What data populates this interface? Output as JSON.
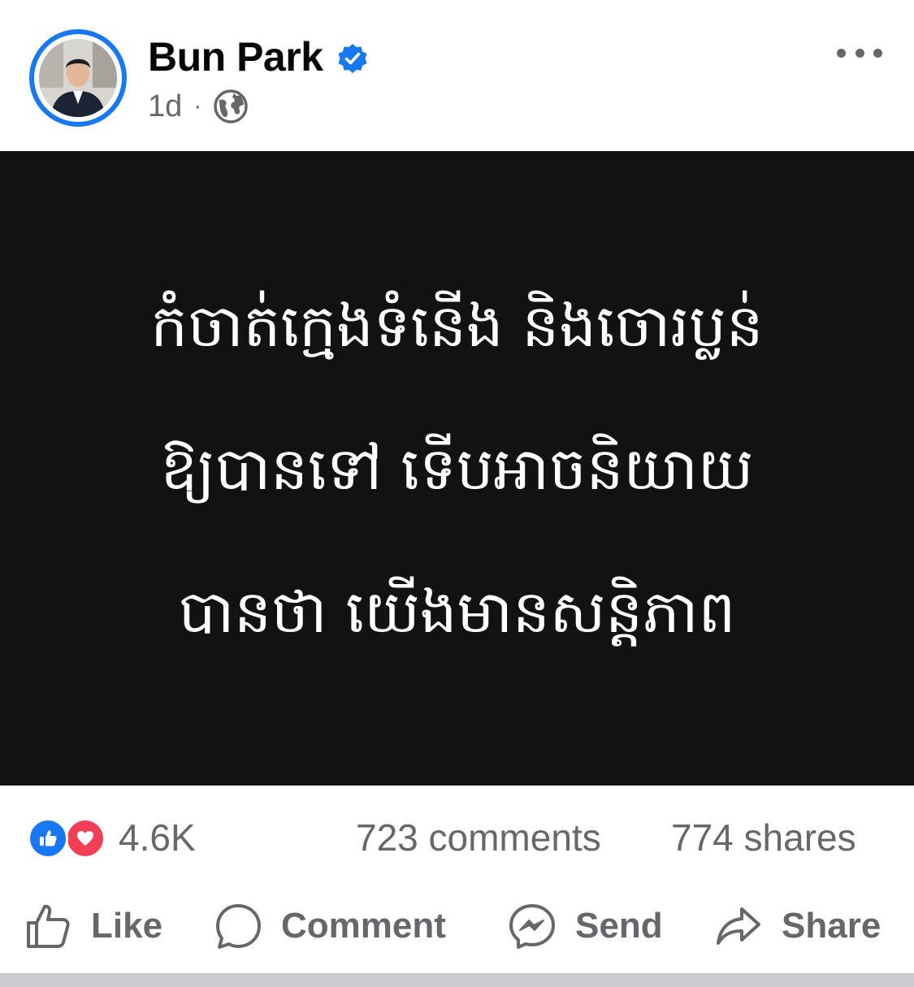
{
  "post": {
    "author": "Bun Park",
    "verified_icon": "verified-badge-icon",
    "time": "1d",
    "separator": "·",
    "audience_icon": "globe-icon",
    "more_icon": "more-options-icon"
  },
  "content": {
    "lines": [
      "កំចាត់ក្មេងទំនើង និងចោរប្លន់",
      "ឱ្យបានទៅ ទើបអាចនិយាយ",
      "បានថា យើងមានសន្តិភាព"
    ],
    "background": "#121212",
    "text_color": "#ffffff"
  },
  "stats": {
    "reactions_count": "4.6K",
    "reaction_icons": [
      "like-reaction-icon",
      "love-reaction-icon"
    ],
    "comments": "723 comments",
    "shares": "774 shares"
  },
  "actions": {
    "like": "Like",
    "comment": "Comment",
    "send": "Send",
    "share": "Share"
  },
  "colors": {
    "accent": "#1877f2",
    "love": "#f33e58",
    "secondary_text": "#65676b"
  }
}
